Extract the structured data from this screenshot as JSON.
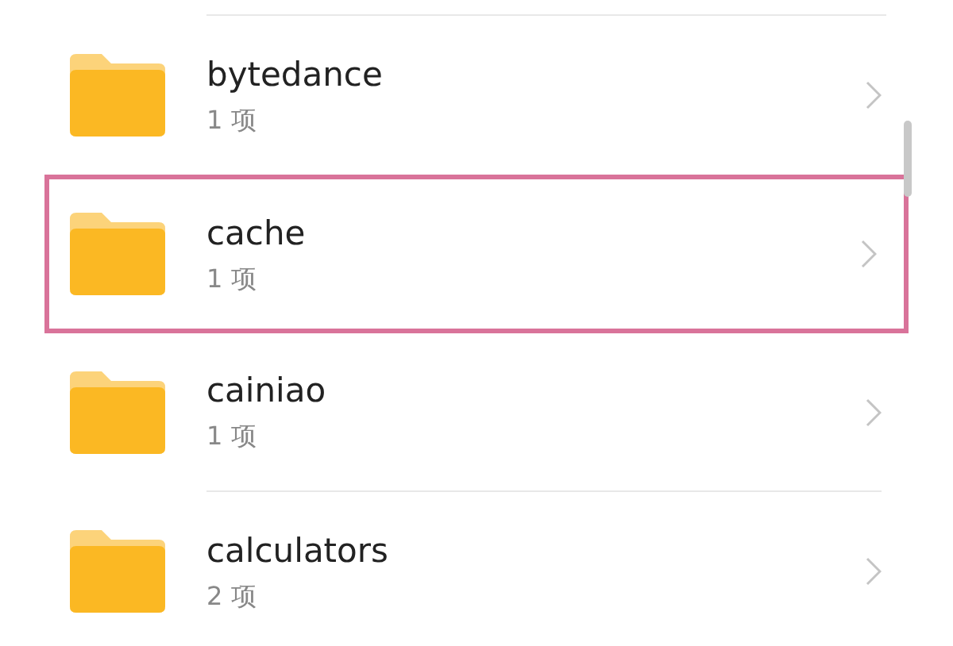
{
  "folders": [
    {
      "name": "bytedance",
      "count": "1 项",
      "highlighted": false
    },
    {
      "name": "cache",
      "count": "1 项",
      "highlighted": true
    },
    {
      "name": "cainiao",
      "count": "1 项",
      "highlighted": false
    },
    {
      "name": "calculators",
      "count": "2 项",
      "highlighted": false
    }
  ]
}
